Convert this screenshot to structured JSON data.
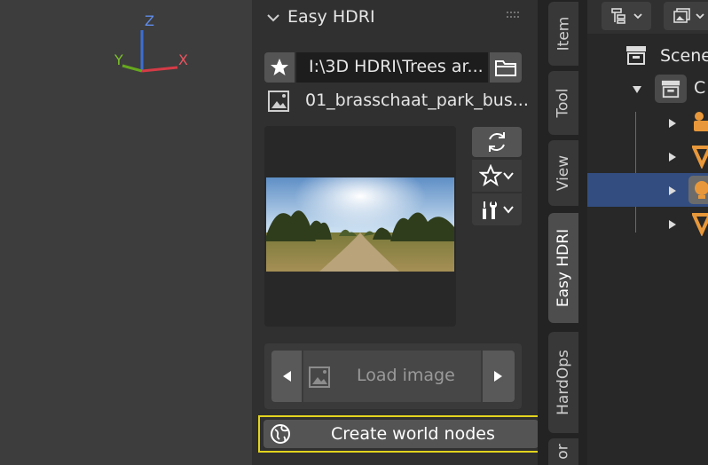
{
  "viewport": {
    "gizmo": {
      "z_label": "Z",
      "y_label": "Y",
      "x_label": "X",
      "colors": {
        "x": "#d53b46",
        "y": "#66a81e",
        "z": "#3b6fd6"
      }
    }
  },
  "panel": {
    "title": "Easy HDRI",
    "path_value": "I:\\3D HDRI\\Trees ar...",
    "image_name": "01_brasschaat_park_bus...",
    "load_image_label": "Load image",
    "create_world_label": "Create world nodes",
    "highlight_color": "#e2d31e"
  },
  "tabs": [
    {
      "label": "Item",
      "active": false
    },
    {
      "label": "Tool",
      "active": false
    },
    {
      "label": "View",
      "active": false
    },
    {
      "label": "Easy HDRI",
      "active": true
    },
    {
      "label": "HardOps",
      "active": false
    },
    {
      "label": "or",
      "active": false
    }
  ],
  "outliner": {
    "scene_label": "Scene",
    "collection_label": "C",
    "selection_color": "#334d80",
    "accent_color": "#e8983a"
  }
}
